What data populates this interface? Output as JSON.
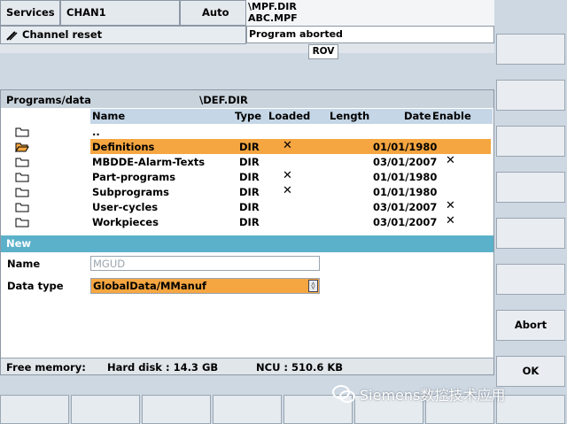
{
  "header": {
    "area": "Services",
    "channel": "CHAN1",
    "mode": "Auto",
    "program_path": "\\MPF.DIR",
    "program_name": "ABC.MPF",
    "channel_status": "Channel reset",
    "program_status": "Program aborted",
    "rov": "ROV"
  },
  "browser": {
    "title": "Programs/data",
    "directory": "\\DEF.DIR",
    "columns": {
      "name": "Name",
      "type": "Type",
      "loaded": "Loaded",
      "length": "Length",
      "date": "Date",
      "enable": "Enable"
    },
    "rows": [
      {
        "name": "..",
        "type": "",
        "loaded": "",
        "date": "",
        "enable": "",
        "icon": "folder-icon"
      },
      {
        "name": "Definitions",
        "type": "DIR",
        "loaded": "✕",
        "date": "01/01/1980",
        "enable": "",
        "icon": "folder-open-icon",
        "selected": true
      },
      {
        "name": "MBDDE-Alarm-Texts",
        "type": "DIR",
        "loaded": "",
        "date": "03/01/2007",
        "enable": "✕",
        "icon": "folder-icon"
      },
      {
        "name": "Part-programs",
        "type": "DIR",
        "loaded": "✕",
        "date": "01/01/1980",
        "enable": "",
        "icon": "folder-icon"
      },
      {
        "name": "Subprograms",
        "type": "DIR",
        "loaded": "✕",
        "date": "01/01/1980",
        "enable": "",
        "icon": "folder-icon"
      },
      {
        "name": "User-cycles",
        "type": "DIR",
        "loaded": "",
        "date": "03/01/2007",
        "enable": "✕",
        "icon": "folder-icon"
      },
      {
        "name": "Workpieces",
        "type": "DIR",
        "loaded": "",
        "date": "03/01/2007",
        "enable": "✕",
        "icon": "folder-icon"
      }
    ]
  },
  "new_dialog": {
    "title": "New",
    "name_label": "Name",
    "name_placeholder": "MGUD",
    "type_label": "Data type",
    "type_value": "GlobalData/MManuf"
  },
  "footer": {
    "free_memory": "Free memory:",
    "hard_disk": "Hard disk : 14.3 GB",
    "ncu": "NCU : 510.6 KB"
  },
  "softkeys": {
    "vertical": [
      "",
      "",
      "",
      "",
      "",
      "",
      "Abort",
      "OK"
    ],
    "horizontal": [
      "",
      "",
      "",
      "",
      "",
      "",
      "",
      ""
    ]
  },
  "watermark": {
    "text": "Siemens数控技术应用"
  },
  "colors": {
    "selection": "#f5a640",
    "accent": "#5bb1c9",
    "header_bg": "#c5d6e6"
  }
}
